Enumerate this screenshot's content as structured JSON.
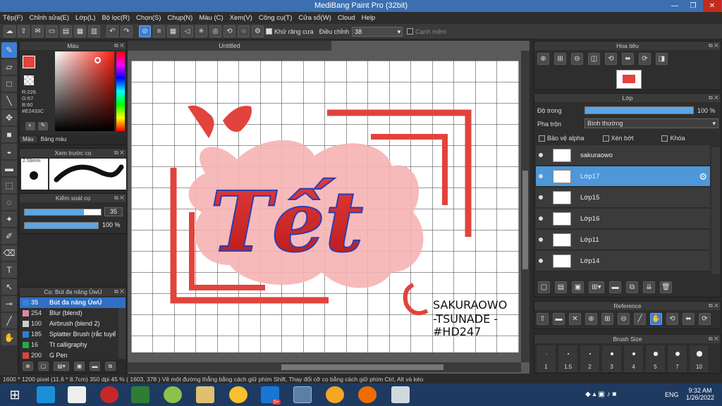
{
  "window": {
    "title": "MediBang Paint Pro (32bit)",
    "min": "—",
    "max": "❐",
    "close": "✕"
  },
  "menu": [
    "Tệp(F)",
    "Chỉnh sửa(E)",
    "Lớp(L)",
    "Bộ lọc(R)",
    "Chọn(S)",
    "Chụp(N)",
    "Màu (C)",
    "Xem(V)",
    "Công cụ(T)",
    "Cửa sổ(W)",
    "Cloud",
    "Help"
  ],
  "toolbar": {
    "antialias_label": "Khử răng cưa",
    "correction_label": "Điều chỉnh",
    "correction_value": "38",
    "snap_label": "Cạnh mềm"
  },
  "color_panel": {
    "title": "Màu",
    "r": "R:226",
    "g": "G:67",
    "b": "B:60",
    "hex": "#E2433C",
    "tab_color": "Màu",
    "tab_palette": "Bảng màu",
    "primary_color": "#E2433C"
  },
  "brush_preview": {
    "title": "Xem trước cọ",
    "size": "2.59mm"
  },
  "brush_control": {
    "title": "Kiểm soát cọ",
    "size_value": "35",
    "opacity_value": "100 %",
    "size_fraction": 0.78,
    "opacity_fraction": 1.0
  },
  "brush_list": {
    "title": "Cọ: Bút đa năng ỦwÚ",
    "items": [
      {
        "value": "35",
        "name": "Bút đa năng ỦwÚ",
        "color": "#3d7fd4",
        "selected": true
      },
      {
        "value": "254",
        "name": "Blur (blend)",
        "color": "#d88aa8"
      },
      {
        "value": "100",
        "name": "Airbrush (blend 2)",
        "color": "#cccccc"
      },
      {
        "value": "185",
        "name": "Splatter Brush (rắc tuyế",
        "color": "#2f7ed8"
      },
      {
        "value": "16",
        "name": "Tt calligraphy",
        "color": "#2aa84a"
      },
      {
        "value": "200",
        "name": "G Pen",
        "color": "#e2433c"
      }
    ]
  },
  "document": {
    "tab": "Untitled"
  },
  "canvas_text": {
    "main": "Tết",
    "sign1": "SAKURAOWO",
    "sign2": "-TSUNADE -",
    "sign3": "#HD247"
  },
  "navigator": {
    "title": "Hoa tiêu"
  },
  "layers": {
    "title": "Lớp",
    "opacity_label": "Độ trong",
    "opacity_value": "100 %",
    "blend_label": "Pha trộn",
    "blend_value": "Bình thường",
    "protect_alpha": "Bảo vệ alpha",
    "clipping": "Xén bớt",
    "lock": "Khóa",
    "items": [
      {
        "name": "sakuraowo"
      },
      {
        "name": "Lớp17",
        "selected": true
      },
      {
        "name": "Lớp15"
      },
      {
        "name": "Lớp16"
      },
      {
        "name": "Lớp11"
      },
      {
        "name": "Lớp14"
      }
    ]
  },
  "reference": {
    "title": "Reference"
  },
  "brush_size": {
    "title": "Brush Size",
    "sizes": [
      "1",
      "1.5",
      "2",
      "3",
      "4",
      "5",
      "7",
      "10"
    ]
  },
  "status": {
    "text": "1600 * 1200 pixel   (11.6 * 8.7cm)   350 dpi   45 %   ( 1603, 378 )   Vẽ một đường thẳng bằng cách giữ phím Shift, Thay đổi cỡ cọ bằng cách giữ phím Ctrl, Alt và kéo"
  },
  "taskbar": {
    "lang": "ENG",
    "time": "9:32 AM",
    "date": "1/26/2022",
    "zalo_badge": "5+"
  }
}
